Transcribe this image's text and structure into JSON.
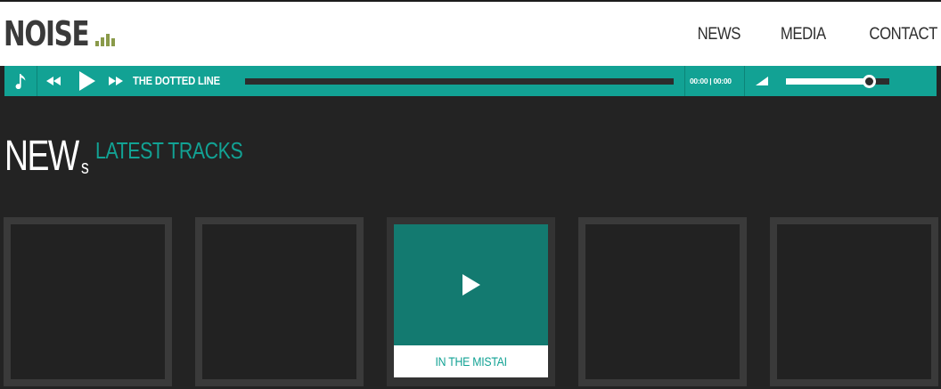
{
  "brand": {
    "logo_text": "NOISE",
    "bar_levels": [
      0.35,
      0.6,
      0.9,
      0.55
    ]
  },
  "nav": {
    "items": [
      "NEWS",
      "MEDIA",
      "CONTACT"
    ]
  },
  "player": {
    "track_title": "THE DOTTED LINE",
    "time_display": "00:00 | 00:00",
    "progress": 0.0,
    "volume": 0.8,
    "icons": [
      "music-note-icon",
      "rewind-icon",
      "play-icon",
      "fast-forward-icon",
      "volume-icon"
    ]
  },
  "section": {
    "title_main": "NEW",
    "title_suffix": "s",
    "subtitle": "LATEST TRACKS"
  },
  "tracks": [
    {
      "title": ""
    },
    {
      "title": ""
    },
    {
      "title": "IN THE MISTAI"
    },
    {
      "title": ""
    },
    {
      "title": ""
    }
  ],
  "colors": {
    "accent": "#12a294",
    "accent_dark": "#137a70",
    "background": "#232323",
    "card_border": "#3a3a3a",
    "logo_bars": "#8a9a4a",
    "header_bg": "#ffffff"
  }
}
